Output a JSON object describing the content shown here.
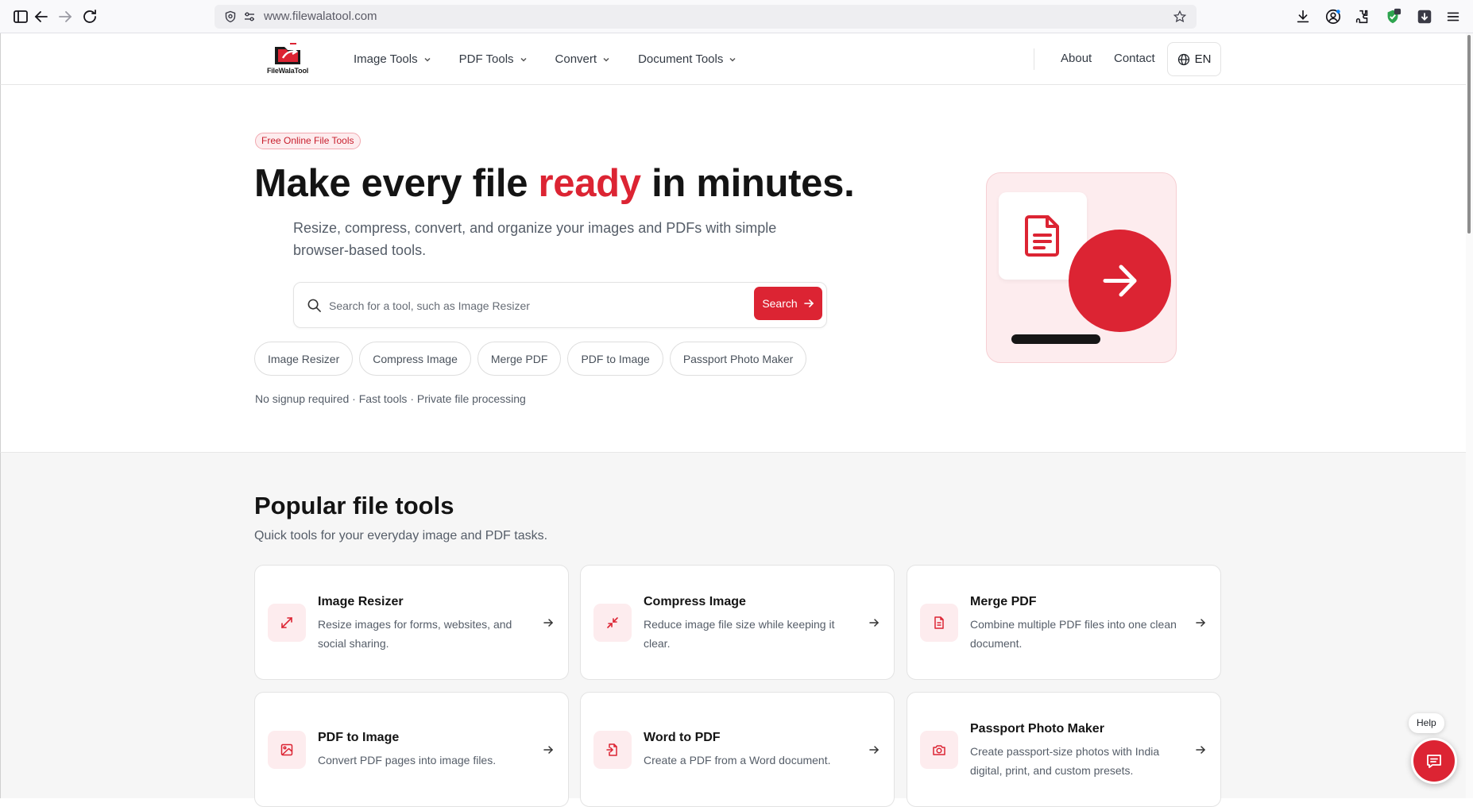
{
  "browser": {
    "url": "www.filewalatool.com"
  },
  "header": {
    "logo_text": "FileWalaTool",
    "nav": [
      {
        "label": "Image Tools"
      },
      {
        "label": "PDF Tools"
      },
      {
        "label": "Convert"
      },
      {
        "label": "Document Tools"
      }
    ],
    "about": "About",
    "contact": "Contact",
    "language": "EN"
  },
  "hero": {
    "badge": "Free Online File Tools",
    "title_before": "Make every file ",
    "title_accent": "ready",
    "title_after": " in minutes.",
    "subtitle": "Resize, compress, convert, and organize your images and PDFs with simple browser-based tools.",
    "search_placeholder": "Search for a tool, such as Image Resizer",
    "search_button": "Search",
    "chips": [
      "Image Resizer",
      "Compress Image",
      "Merge PDF",
      "PDF to Image",
      "Passport Photo Maker"
    ],
    "note": "No signup required · Fast tools · Private file processing"
  },
  "tools": {
    "title": "Popular file tools",
    "subtitle": "Quick tools for your everyday image and PDF tasks.",
    "cards": [
      {
        "title": "Image Resizer",
        "desc": "Resize images for forms, websites, and social sharing.",
        "icon": "expand-icon"
      },
      {
        "title": "Compress Image",
        "desc": "Reduce image file size while keeping it clear.",
        "icon": "compress-icon"
      },
      {
        "title": "Merge PDF",
        "desc": "Combine multiple PDF files into one clean document.",
        "icon": "document-icon"
      },
      {
        "title": "PDF to Image",
        "desc": "Convert PDF pages into image files.",
        "icon": "image-icon"
      },
      {
        "title": "Word to PDF",
        "desc": "Create a PDF from a Word document.",
        "icon": "file-import-icon"
      },
      {
        "title": "Passport Photo Maker",
        "desc": "Create passport-size photos with India digital, print, and custom presets.",
        "icon": "camera-icon"
      }
    ]
  },
  "help": {
    "label": "Help"
  },
  "colors": {
    "accent": "#dc2433",
    "accent_soft": "#fdecee",
    "text": "#141414",
    "muted": "#555d68"
  }
}
